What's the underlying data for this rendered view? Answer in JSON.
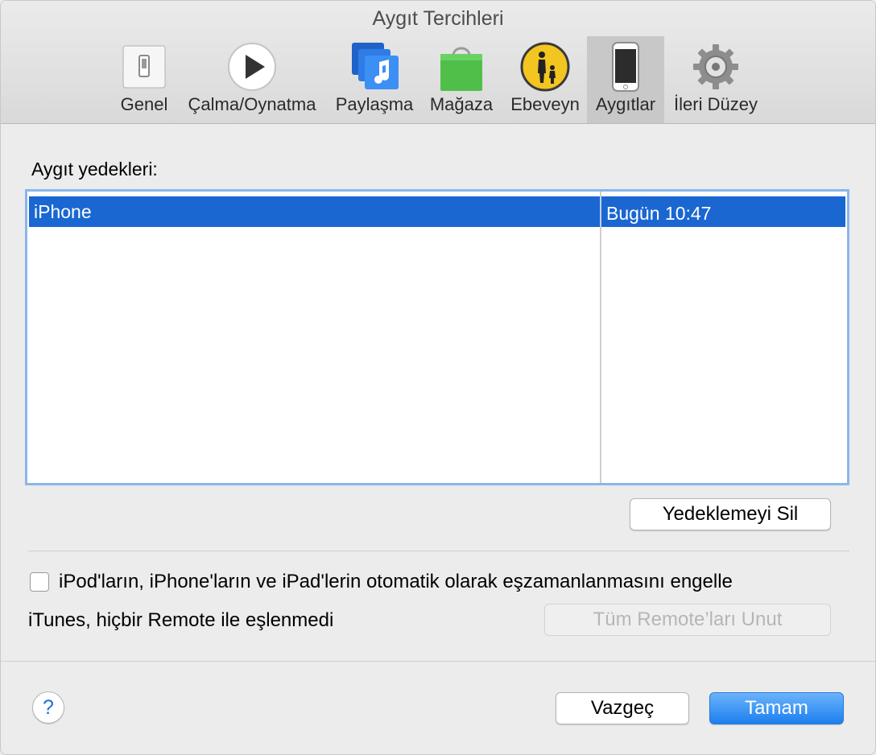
{
  "window": {
    "title": "Aygıt Tercihleri"
  },
  "tabs": [
    {
      "label": "Genel",
      "icon": "switch-icon"
    },
    {
      "label": "Çalma/Oynatma",
      "icon": "play-icon"
    },
    {
      "label": "Paylaşma",
      "icon": "music-share-icon"
    },
    {
      "label": "Mağaza",
      "icon": "shopping-bag-icon"
    },
    {
      "label": "Ebeveyn",
      "icon": "parental-icon"
    },
    {
      "label": "Aygıtlar",
      "icon": "iphone-icon",
      "active": true
    },
    {
      "label": "İleri Düzey",
      "icon": "gear-icon"
    }
  ],
  "backups": {
    "label": "Aygıt yedekleri:",
    "rows": [
      {
        "device": "iPhone",
        "date": "Bugün 10:47",
        "selected": true
      }
    ],
    "delete_button": "Yedeklemeyi Sil"
  },
  "options": {
    "prevent_sync_label": "iPod'ların, iPhone'ların ve iPad'lerin otomatik olarak eşzamanlanmasını engelle",
    "prevent_sync_checked": false,
    "remote_status": "iTunes, hiçbir Remote ile eşlenmedi",
    "forget_remotes_button": "Tüm Remote’ları Unut"
  },
  "footer": {
    "help": "?",
    "cancel": "Vazgeç",
    "ok": "Tamam"
  },
  "colors": {
    "selection": "#1a67d2",
    "focus_ring": "#8ab6ea",
    "primary_button": "#1c7fef"
  }
}
